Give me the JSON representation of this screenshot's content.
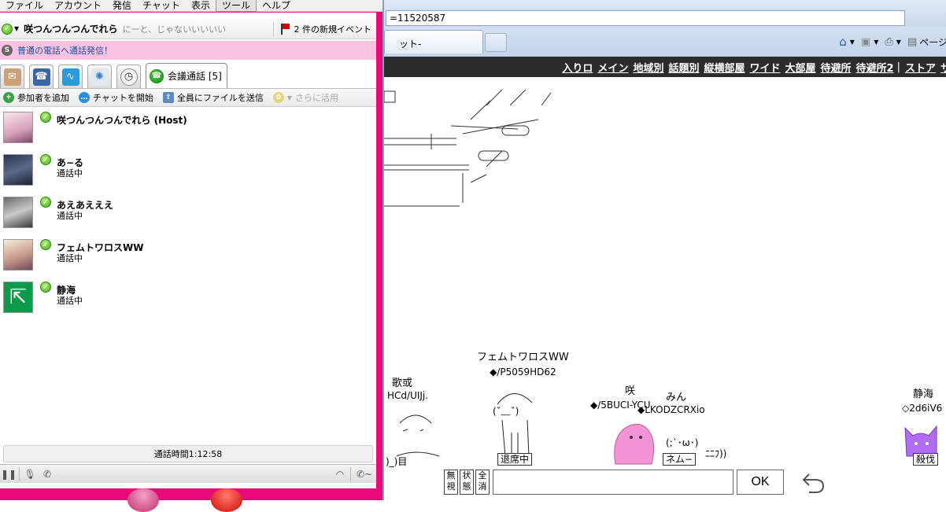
{
  "menubar": [
    "ファイル",
    "アカウント",
    "発信",
    "チャット",
    "表示",
    "ツール",
    "ヘルプ"
  ],
  "skype": {
    "user_name": "咲つんつんつんでれら",
    "mood": "にーと、じゃないいいいい",
    "events": "2 件の新規イベント",
    "phone_banner": "普通の電話へ通話発信！",
    "conference_tab": "会議通話 [5]",
    "toolbar": {
      "add": "参加者を追加",
      "chat": "チャットを開始",
      "send_file": "全員にファイルを送信",
      "more": "さらに活用"
    },
    "participants": [
      {
        "name": "咲つんつんつんでれら (Host)",
        "status": ""
      },
      {
        "name": "あ−る",
        "status": "通話中"
      },
      {
        "name": "あえあえええ",
        "status": "通話中"
      },
      {
        "name": "フェムトワロスWW",
        "status": "通話中"
      },
      {
        "name": "静海",
        "status": "通話中"
      }
    ],
    "call_time": "通話時間1:12:58"
  },
  "browser": {
    "address": "=11520587",
    "tab_title": "ット-",
    "tools_page": "ページ",
    "nav": [
      "入りロ",
      "メイン",
      "地域別",
      "話題別",
      "縦横部屋",
      "ワイド",
      "大部屋",
      "待避所",
      "待避所2",
      "ストア",
      "サ"
    ],
    "nav_separator": "|"
  },
  "chat": {
    "characters": [
      {
        "name": "歌或",
        "trip": "HCd/UIJj."
      },
      {
        "name": "フェムトワロスWW",
        "trip": "◆/P5059HD62",
        "label": "退席中"
      },
      {
        "name": "咲",
        "trip": "◆/5BUCI-YCU"
      },
      {
        "name": "みん",
        "trip": "◆LKODZCRXio",
        "label": "ネム−"
      },
      {
        "name": "静海",
        "trip": "◇2d6iV6",
        "label": "殺伐"
      }
    ],
    "buttons": {
      "ignore": "無視",
      "status": "状態",
      "clear": "全消"
    },
    "ok": "OK",
    "aa_face1": "(ˇ﹏ˇ)",
    "aa_face2": "(;`･ω･)",
    "aa_extra": "ﾆﾆﾌ))",
    "aa_bottom": ")_)目"
  },
  "colors": {
    "skype_frame": "#e8097a",
    "banner": "#fbc3e2",
    "nav_bar": "#2c2c2c",
    "saki_avatar": "#f493d6",
    "shizumi_avatar": "#b06cf2"
  }
}
